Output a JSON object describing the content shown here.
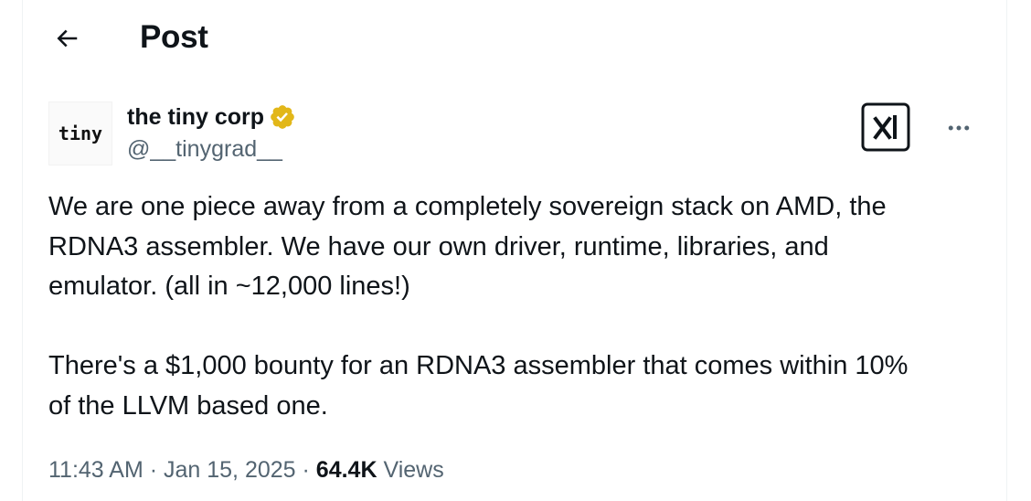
{
  "header": {
    "back_icon": "arrow-left-icon",
    "title": "Post"
  },
  "author": {
    "avatar_text": "tiny",
    "display_name": "the tiny corp",
    "verified_icon": "verified-badge-icon",
    "verified_color": "#e2b719",
    "handle": "@__tinygrad__",
    "grok_icon": "grok-icon",
    "more_icon": "more-dots-icon"
  },
  "tweet": {
    "text": "We are one piece away from a completely sovereign stack on AMD, the\nRDNA3 assembler. We have our own driver, runtime, libraries, and\nemulator. (all in ~12,000 lines!)\n\nThere's a $1,000 bounty for an RDNA3 assembler that comes within 10%\nof the LLVM based one."
  },
  "meta": {
    "time": "11:43 AM",
    "separator": " · ",
    "date": "Jan 15, 2025",
    "views_count": "64.4K",
    "views_label": "Views"
  },
  "colors": {
    "text": "#0f1419",
    "secondary": "#536471",
    "border": "#eff3f4"
  }
}
